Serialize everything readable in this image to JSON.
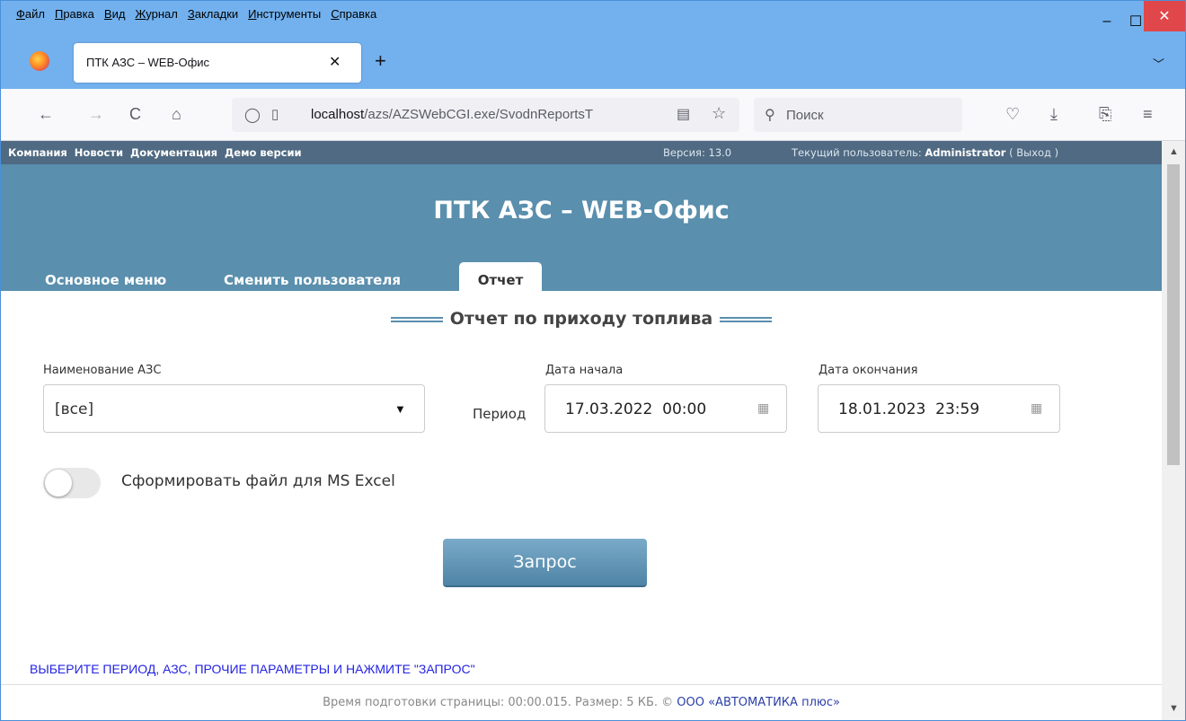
{
  "window": {
    "menus": [
      "Файл",
      "Правка",
      "Вид",
      "Журнал",
      "Закладки",
      "Инструменты",
      "Справка"
    ],
    "minimize": "–",
    "maximize": "☐",
    "close": "✕"
  },
  "tab": {
    "title": "ПТК АЗС – WEB-Офис",
    "close": "✕",
    "new_tab": "+",
    "overflow": "﹀"
  },
  "nav": {
    "back": "←",
    "forward": "→",
    "reload": "C",
    "home": "⌂",
    "url_host": "localhost",
    "url_path": "/azs/AZSWebCGI.exe/SvodnReportsT",
    "search_placeholder": "Поиск"
  },
  "site": {
    "top_links": [
      "Компания",
      "Новости",
      "Документация",
      "Демо версии"
    ],
    "version": "Версия: 13.0",
    "user_label": "Текущий пользователь: ",
    "user_name": "Administrator",
    "logout": " ( Выход )",
    "app_title": "ПТК АЗС – WEB-Офис",
    "tabs": {
      "main": "Основное меню",
      "switch_user": "Сменить пользователя",
      "report": "Отчет"
    }
  },
  "form": {
    "report_title": "Отчет по приходу топлива",
    "azs_label": "Наименование АЗС",
    "azs_value": "[все]",
    "period_label": "Период",
    "start_label": "Дата начала",
    "start_value": "17.03.2022  00:00",
    "end_label": "Дата окончания",
    "end_value": "18.01.2023  23:59",
    "excel_label": "Сформировать файл для MS Excel",
    "excel_enabled": false,
    "query_button": "Запрос"
  },
  "hint": "ВЫБЕРИТЕ ПЕРИОД, АЗС, ПРОЧИЕ ПАРАМЕТРЫ И НАЖМИТЕ \"ЗАПРОС\"",
  "footer": {
    "text": "Время подготовки страницы: 00:00.015. Размер: 5 КБ. © ",
    "company": "ООО «АВТОМАТИКА плюс»"
  },
  "icons": {
    "calendar": "calendar-icon",
    "dropdown": "chevron-down-icon"
  },
  "colors": {
    "header": "#5a8fad",
    "topline": "#4f6a82",
    "hint": "#2323e3",
    "chrome": "#72b1ee"
  }
}
